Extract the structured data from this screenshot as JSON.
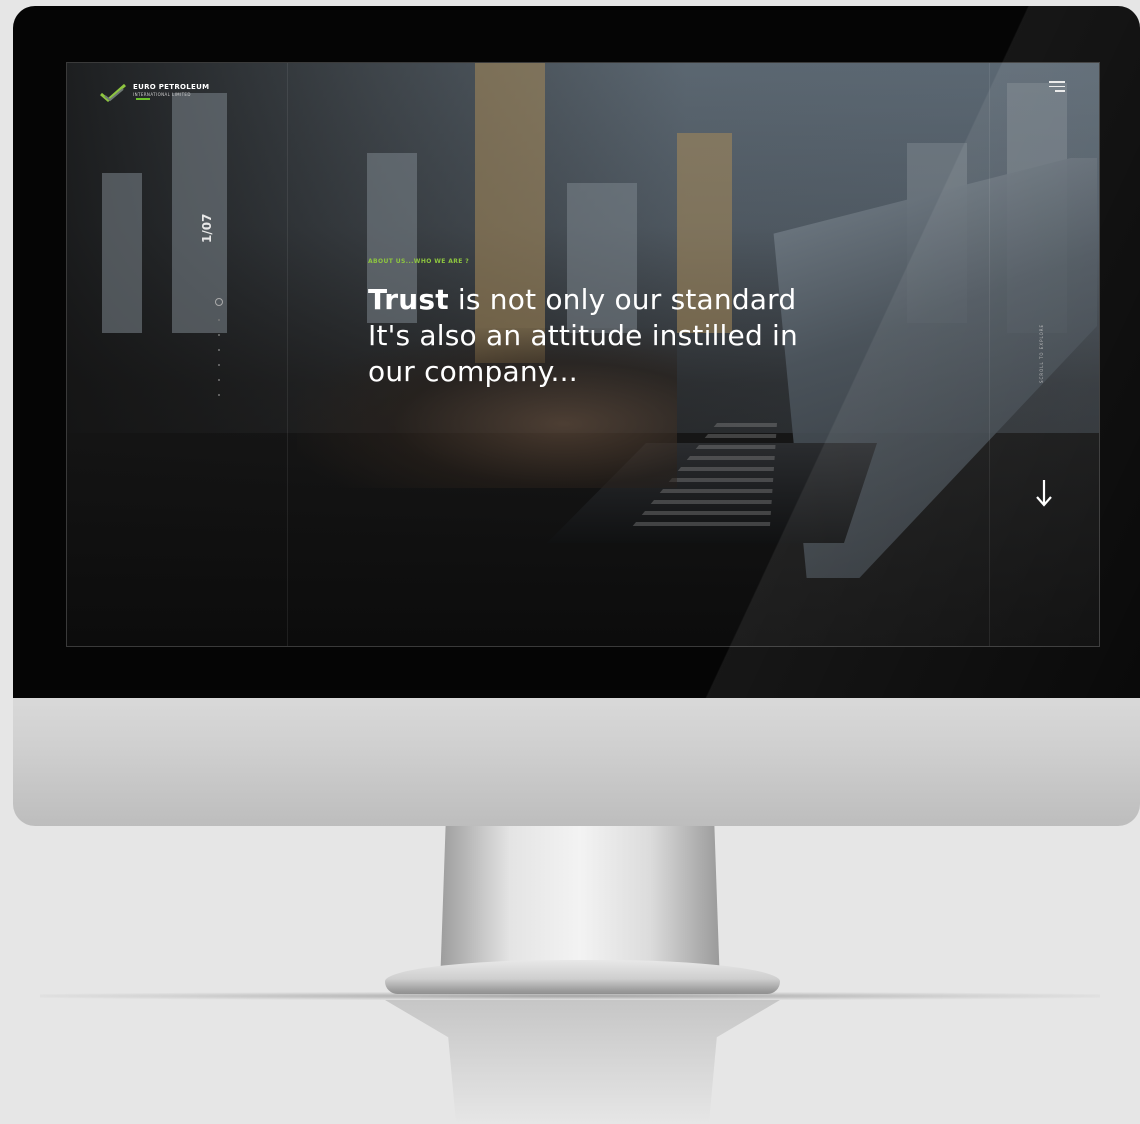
{
  "site": {
    "logo_name": "EURO PETROLEUM",
    "logo_sub": "INTERNATIONAL LIMITED",
    "logo_tagline": "",
    "brand_color": "#8ec63f"
  },
  "nav": {
    "menu_icon": "hamburger-menu-icon"
  },
  "slider": {
    "counter": "1/07",
    "eyebrow": "ABOUT US...WHO WE ARE ?",
    "headline_bold": "Trust",
    "headline_rest_1": " is not only our standard",
    "headline_line_2": "It's also an attitude instilled in",
    "headline_line_3": "our company..."
  },
  "scroll": {
    "label": "SCROLL TO EXPLORE",
    "arrow_icon": "arrow-down-icon"
  }
}
